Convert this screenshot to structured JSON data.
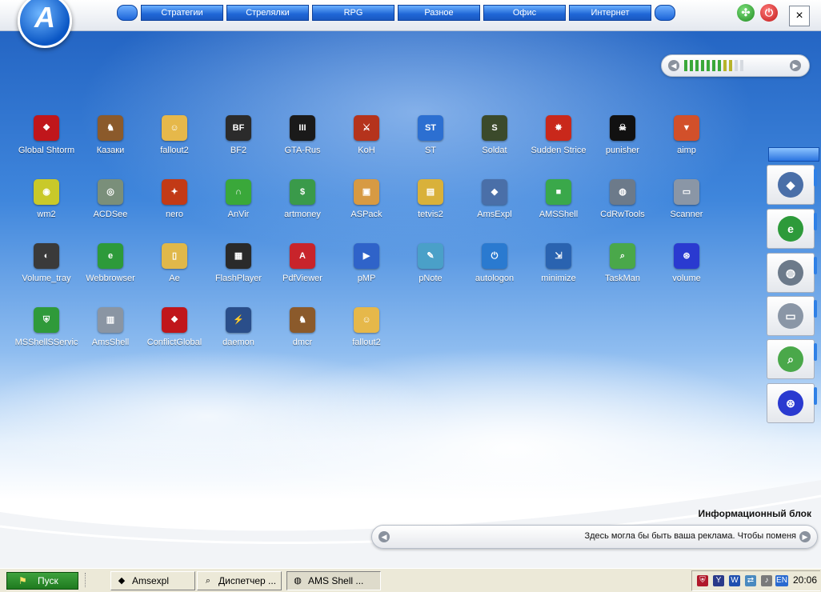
{
  "topbar": {
    "logo": "A",
    "categories": [
      "Стратегии",
      "Стрелялки",
      "RPG",
      "Разное",
      "Офис",
      "Интернет"
    ],
    "buttons": {
      "green": "arrows-icon",
      "power": "power-icon",
      "close": "×"
    }
  },
  "icons": [
    {
      "label": "Global Shtorm",
      "icon": "eagle-icon",
      "color": "#c0161b",
      "glyph": "❖"
    },
    {
      "label": "Казаки",
      "icon": "cossacks-icon",
      "color": "#8b5a2b",
      "glyph": "♞"
    },
    {
      "label": "fallout2",
      "icon": "vault-boy-icon",
      "color": "#e6b84a",
      "glyph": "☺"
    },
    {
      "label": "BF2",
      "icon": "battlefield-icon",
      "color": "#2b2b2b",
      "glyph": "BF"
    },
    {
      "label": "GTA-Rus",
      "icon": "gta-icon",
      "color": "#1a1a1a",
      "glyph": "III"
    },
    {
      "label": "KoH",
      "icon": "helmet-icon",
      "color": "#b5331c",
      "glyph": "⚔"
    },
    {
      "label": "ST",
      "icon": "st-icon",
      "color": "#2c6fd1",
      "glyph": "ST"
    },
    {
      "label": "Soldat",
      "icon": "soldat-icon",
      "color": "#3b4a2b",
      "glyph": "S"
    },
    {
      "label": "Sudden Strice",
      "icon": "explosion-icon",
      "color": "#c9281b",
      "glyph": "✸"
    },
    {
      "label": "punisher",
      "icon": "skull-icon",
      "color": "#111111",
      "glyph": "☠"
    },
    {
      "label": "aimp",
      "icon": "aimp-icon",
      "color": "#d2502a",
      "glyph": "▼"
    },
    {
      "label": "wm2",
      "icon": "alien-icon",
      "color": "#c9c92a",
      "glyph": "◉"
    },
    {
      "label": "ACDSee",
      "icon": "eye-icon",
      "color": "#7a8f7a",
      "glyph": "◎"
    },
    {
      "label": "nero",
      "icon": "nero-icon",
      "color": "#c23a16",
      "glyph": "✦"
    },
    {
      "label": "AnVir",
      "icon": "rainbow-icon",
      "color": "#3aa83a",
      "glyph": "∩"
    },
    {
      "label": "artmoney",
      "icon": "money-icon",
      "color": "#3a9a4a",
      "glyph": "$"
    },
    {
      "label": "ASPack",
      "icon": "package-icon",
      "color": "#d79a43",
      "glyph": "▣"
    },
    {
      "label": "tetvis2",
      "icon": "blocks-icon",
      "color": "#d9b13a",
      "glyph": "▤"
    },
    {
      "label": "AmsExpl",
      "icon": "explorer-icon",
      "color": "#4a6fa8",
      "glyph": "◆"
    },
    {
      "label": "AMSShell",
      "icon": "cubes-icon",
      "color": "#3aa84a",
      "glyph": "■"
    },
    {
      "label": "CdRwTools",
      "icon": "disc-icon",
      "color": "#6c7a8a",
      "glyph": "◍"
    },
    {
      "label": "Scanner",
      "icon": "printer-icon",
      "color": "#8a96a6",
      "glyph": "▭"
    },
    {
      "label": "Volume_tray",
      "icon": "speaker-icon",
      "color": "#3a3a3a",
      "glyph": "◐"
    },
    {
      "label": "Webbrowser",
      "icon": "ie-icon",
      "color": "#2d9a3a",
      "glyph": "e"
    },
    {
      "label": "Ae",
      "icon": "folder-icon",
      "color": "#e0b84a",
      "glyph": "▯"
    },
    {
      "label": "FlashPlayer",
      "icon": "film-icon",
      "color": "#2a2a2a",
      "glyph": "▦"
    },
    {
      "label": "PdfViewer",
      "icon": "pdf-icon",
      "color": "#c8242b",
      "glyph": "A"
    },
    {
      "label": "pMP",
      "icon": "play-icon",
      "color": "#2f63c9",
      "glyph": "▶"
    },
    {
      "label": "pNote",
      "icon": "notepad-icon",
      "color": "#4aa0c8",
      "glyph": "✎"
    },
    {
      "label": "autologon",
      "icon": "power-button-icon",
      "color": "#2a7ad0",
      "glyph": "⏻"
    },
    {
      "label": "minimize",
      "icon": "minimize-icon",
      "color": "#2a63b0",
      "glyph": "⇲"
    },
    {
      "label": "TaskMan",
      "icon": "search-folder-icon",
      "color": "#4aa84a",
      "glyph": "⌕"
    },
    {
      "label": "volume",
      "icon": "satellite-icon",
      "color": "#2a3ad0",
      "glyph": "⊛"
    },
    {
      "label": "MSShellSServic",
      "icon": "shield-icon",
      "color": "#2f9a3a",
      "glyph": "⛨"
    },
    {
      "label": "AmsShell",
      "icon": "server-icon",
      "color": "#8a95a3",
      "glyph": "▥"
    },
    {
      "label": "ConflictGlobal",
      "icon": "eagle-icon",
      "color": "#c0161b",
      "glyph": "❖"
    },
    {
      "label": "daemon",
      "icon": "daemon-icon",
      "color": "#2a4e8a",
      "glyph": "⚡"
    },
    {
      "label": "dmcr",
      "icon": "cossacks-icon",
      "color": "#8b5a2b",
      "glyph": "♞"
    },
    {
      "label": "fallout2",
      "icon": "vault-boy-icon",
      "color": "#e6b84a",
      "glyph": "☺"
    }
  ],
  "progress": {
    "filled": 9,
    "total": 11
  },
  "dock": [
    {
      "icon": "explorer-icon",
      "glyph": "◆",
      "color": "#4a6fa8"
    },
    {
      "icon": "ie-icon",
      "glyph": "e",
      "color": "#2d9a3a"
    },
    {
      "icon": "disc-icon",
      "glyph": "◍",
      "color": "#6c7a8a"
    },
    {
      "icon": "printer-icon",
      "glyph": "▭",
      "color": "#8a96a6"
    },
    {
      "icon": "search-folder-icon",
      "glyph": "⌕",
      "color": "#4aa84a"
    },
    {
      "icon": "satellite-icon",
      "glyph": "⊛",
      "color": "#2a3ad0"
    }
  ],
  "info": {
    "title": "Информационный блок",
    "text": "Здесь могла бы быть ваша реклама. Чтобы поменя"
  },
  "taskbar": {
    "start": "Пуск",
    "tasks": [
      {
        "label": "Amsexpl",
        "icon": "explorer-icon",
        "glyph": "◆"
      },
      {
        "label": "Диспетчер ...",
        "icon": "search-folder-icon",
        "glyph": "⌕"
      },
      {
        "label": "AMS Shell ...",
        "icon": "disc-icon",
        "glyph": "◍"
      }
    ],
    "tray": [
      "shield-icon",
      "y-icon",
      "w-icon",
      "network-icon",
      "volume-icon"
    ],
    "lang": "EN",
    "clock": "20:06"
  }
}
